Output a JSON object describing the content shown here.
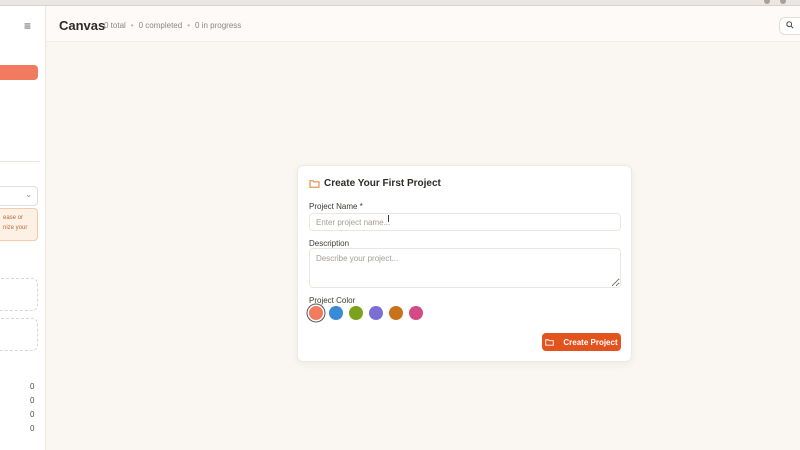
{
  "header": {
    "title": "Canvas",
    "stat_total": "0 total",
    "stat_completed": "0 completed",
    "stat_in_progress": "0 in progress",
    "stat_separator": "•"
  },
  "sidebar": {
    "note_text_1": "ease or",
    "note_text_2": "nize your",
    "counts": [
      "0",
      "0",
      "0",
      "0"
    ]
  },
  "card": {
    "title": "Create Your First Project",
    "name_label": "Project Name *",
    "name_placeholder": "Enter project name...",
    "description_label": "Description",
    "description_placeholder": "Describe your project...",
    "color_label": "Project Color",
    "create_button": "Create Project"
  },
  "colors": {
    "accent": "#e2531d",
    "swatches": [
      "#f27a5e",
      "#3b8ad6",
      "#7ba21a",
      "#7b6fd6",
      "#c7731b",
      "#d24b86"
    ],
    "selected_swatch": 0
  }
}
